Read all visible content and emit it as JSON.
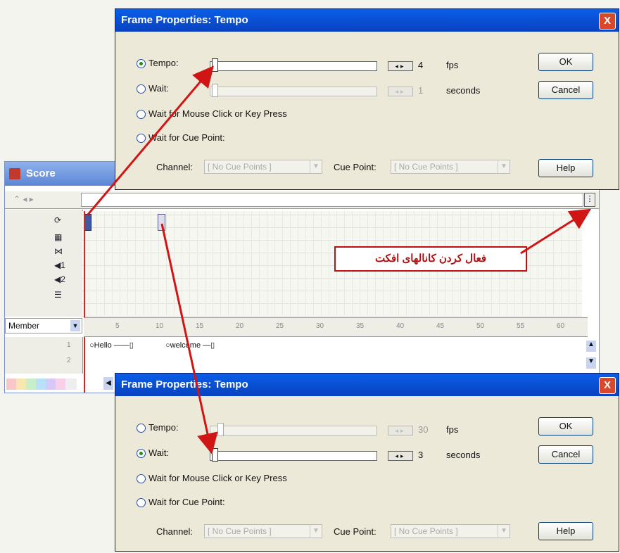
{
  "top_dialog": {
    "title": "Frame Properties: Tempo",
    "close": "X",
    "options": {
      "tempo": "Tempo:",
      "wait": "Wait:",
      "mouse": "Wait for Mouse Click or Key Press",
      "cue": "Wait for Cue Point:"
    },
    "tempo_value": "4",
    "tempo_unit": "fps",
    "wait_value": "1",
    "wait_unit": "seconds",
    "channel_label": "Channel:",
    "channel_value": "[ No Cue Points ]",
    "cue_label": "Cue Point:",
    "cue_value": "[ No Cue Points ]",
    "ok": "OK",
    "cancel": "Cancel",
    "help": "Help",
    "selected": "tempo"
  },
  "score": {
    "title": "Score",
    "member_label": "Member",
    "sprite_1": "Hello",
    "sprite_2": "welcome",
    "row_1": "1",
    "row_2": "2",
    "ruler_ticks": [
      "5",
      "10",
      "15",
      "20",
      "25",
      "30",
      "35",
      "40",
      "45",
      "50",
      "55",
      "60"
    ],
    "annotation": "فعال کردن کانالهای افکت"
  },
  "bottom_dialog": {
    "title": "Frame Properties: Tempo",
    "close": "X",
    "options": {
      "tempo": "Tempo:",
      "wait": "Wait:",
      "mouse": "Wait for Mouse Click or Key Press",
      "cue": "Wait for Cue Point:"
    },
    "tempo_value": "30",
    "tempo_unit": "fps",
    "wait_value": "3",
    "wait_unit": "seconds",
    "channel_label": "Channel:",
    "channel_value": "[ No Cue Points ]",
    "cue_label": "Cue Point:",
    "cue_value": "[ No Cue Points ]",
    "ok": "OK",
    "cancel": "Cancel",
    "help": "Help",
    "selected": "wait"
  },
  "colors": {
    "titlebar": "#0a5ee8",
    "annotation_border": "#c01010",
    "arrow": "#d01515"
  }
}
